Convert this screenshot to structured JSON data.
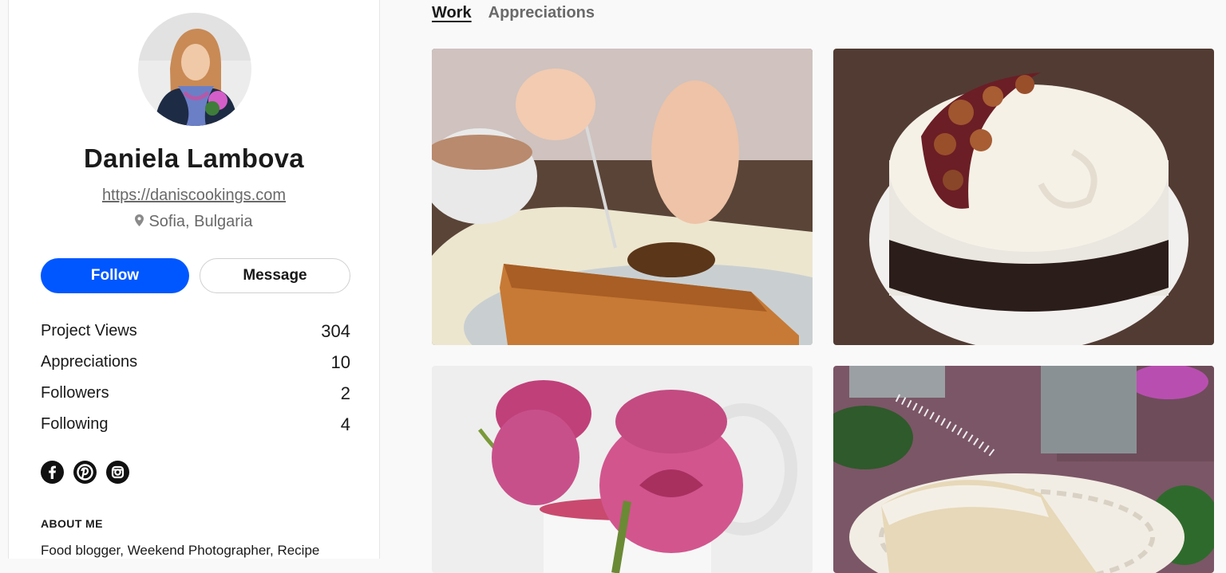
{
  "profile": {
    "name": "Daniela Lambova",
    "website": "https://daniscookings.com",
    "location": "Sofia, Bulgaria",
    "avatar_icon": "profile-photo"
  },
  "actions": {
    "follow_label": "Follow",
    "message_label": "Message"
  },
  "stats": [
    {
      "label": "Project Views",
      "value": "304"
    },
    {
      "label": "Appreciations",
      "value": "10"
    },
    {
      "label": "Followers",
      "value": "2"
    },
    {
      "label": "Following",
      "value": "4"
    }
  ],
  "social": [
    "facebook-icon",
    "pinterest-icon",
    "instagram-icon"
  ],
  "about": {
    "title": "ABOUT ME",
    "text": "Food blogger, Weekend Photographer, Recipe"
  },
  "tabs": [
    {
      "label": "Work",
      "active": true
    },
    {
      "label": "Appreciations",
      "active": false
    }
  ],
  "projects": [
    {
      "thumbnail": "loaf-cake-with-jam"
    },
    {
      "thumbnail": "cream-cake-with-hazelnuts"
    },
    {
      "thumbnail": "pink-roses"
    },
    {
      "thumbnail": "powdered-sugar-roll-cake"
    }
  ],
  "colors": {
    "accent": "#0057ff",
    "text": "#191919",
    "muted": "#696969",
    "background": "#f9f9f9"
  }
}
